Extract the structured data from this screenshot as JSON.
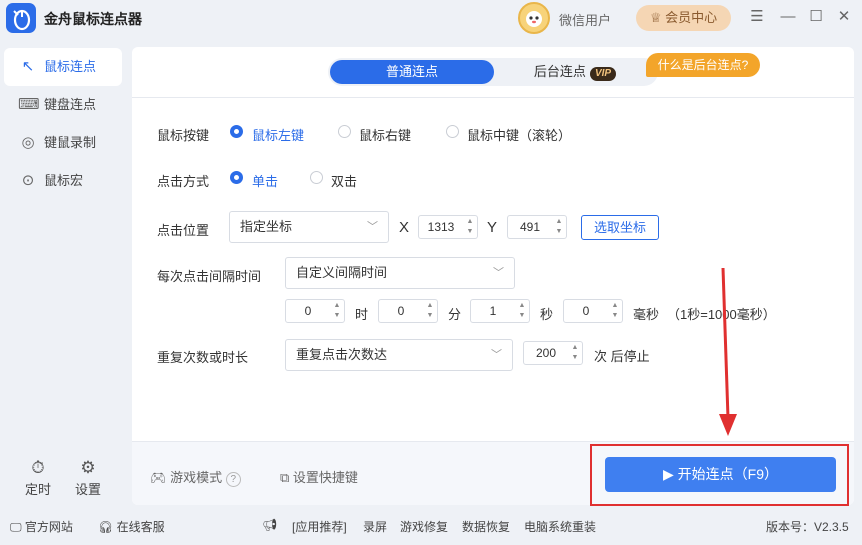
{
  "app": {
    "title": "金舟鼠标连点器",
    "version": "版本号：V2.3.5"
  },
  "header": {
    "user_label": "微信用户",
    "vip_label": "会员中心"
  },
  "sidebar": {
    "items": [
      {
        "label": "鼠标连点",
        "icon": "mouse-click-icon",
        "active": true
      },
      {
        "label": "键盘连点",
        "icon": "keyboard-icon",
        "active": false
      },
      {
        "label": "键鼠录制",
        "icon": "record-icon",
        "active": false
      },
      {
        "label": "鼠标宏",
        "icon": "mouse-icon",
        "active": false
      }
    ],
    "bottom": [
      {
        "label": "定时",
        "icon": "timer-icon"
      },
      {
        "label": "设置",
        "icon": "settings-icon"
      }
    ]
  },
  "tabs": {
    "normal": "普通连点",
    "background": "后台连点",
    "vip_badge": "VIP",
    "tip": "什么是后台连点?"
  },
  "form": {
    "mouse_button": {
      "label": "鼠标按键",
      "options": [
        "鼠标左键",
        "鼠标右键",
        "鼠标中键（滚轮）"
      ],
      "selected": 0
    },
    "click_type": {
      "label": "点击方式",
      "options": [
        "单击",
        "双击"
      ],
      "selected": 0
    },
    "position": {
      "label": "点击位置",
      "mode": "指定坐标",
      "x_label": "X",
      "x": "1313",
      "y_label": "Y",
      "y": "491",
      "pick_button": "选取坐标"
    },
    "interval": {
      "label": "每次点击间隔时间",
      "mode": "自定义间隔时间",
      "hours": "0",
      "hours_unit": "时",
      "minutes": "0",
      "minutes_unit": "分",
      "seconds": "1",
      "seconds_unit": "秒",
      "ms": "0",
      "ms_unit": "毫秒",
      "note": "（1秒=1000毫秒）"
    },
    "repeat": {
      "label": "重复次数或时长",
      "mode": "重复点击次数达",
      "count": "200",
      "suffix": "次 后停止"
    }
  },
  "footer": {
    "game_mode": "游戏模式",
    "shortcut": "设置快捷键",
    "start_button": "开始连点（F9）"
  },
  "statusbar": {
    "website": "官方网站",
    "support": "在线客服",
    "recommend": "[应用推荐]",
    "links": [
      "录屏",
      "游戏修复",
      "数据恢复",
      "电脑系统重装"
    ]
  },
  "colors": {
    "accent": "#2b6ce8",
    "start_button": "#3f7ff0",
    "tip": "#f3a52a",
    "highlight_box": "#e03030"
  }
}
